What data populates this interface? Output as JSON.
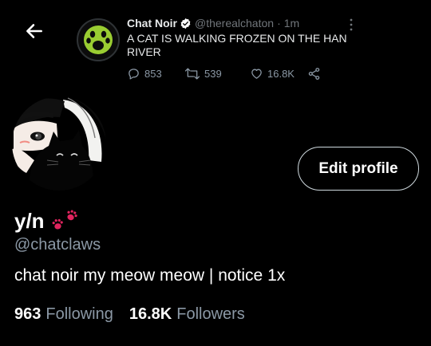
{
  "colors": {
    "background": "#000000",
    "muted": "#8b98a5",
    "verified_badge": "#ffffff",
    "paw": "#e0245e",
    "cat_avatar_bg": "#9acd32"
  },
  "nav": {
    "back_icon": "arrow-left-icon"
  },
  "tweet": {
    "author_name": "Chat Noir",
    "author_handle": "@therealchaton",
    "separator": "·",
    "time": "1m",
    "text": "A CAT IS WALKING FROZEN ON THE HAN RIVER",
    "replies": "853",
    "retweets": "539",
    "likes": "16.8K"
  },
  "profile": {
    "display_name": "y/n",
    "handle": "@chatclaws",
    "bio": "chat noir my meow meow | notice 1x",
    "edit_button": "Edit profile",
    "following_count": "963",
    "following_label": "Following",
    "followers_count": "16.8K",
    "followers_label": "Followers"
  }
}
